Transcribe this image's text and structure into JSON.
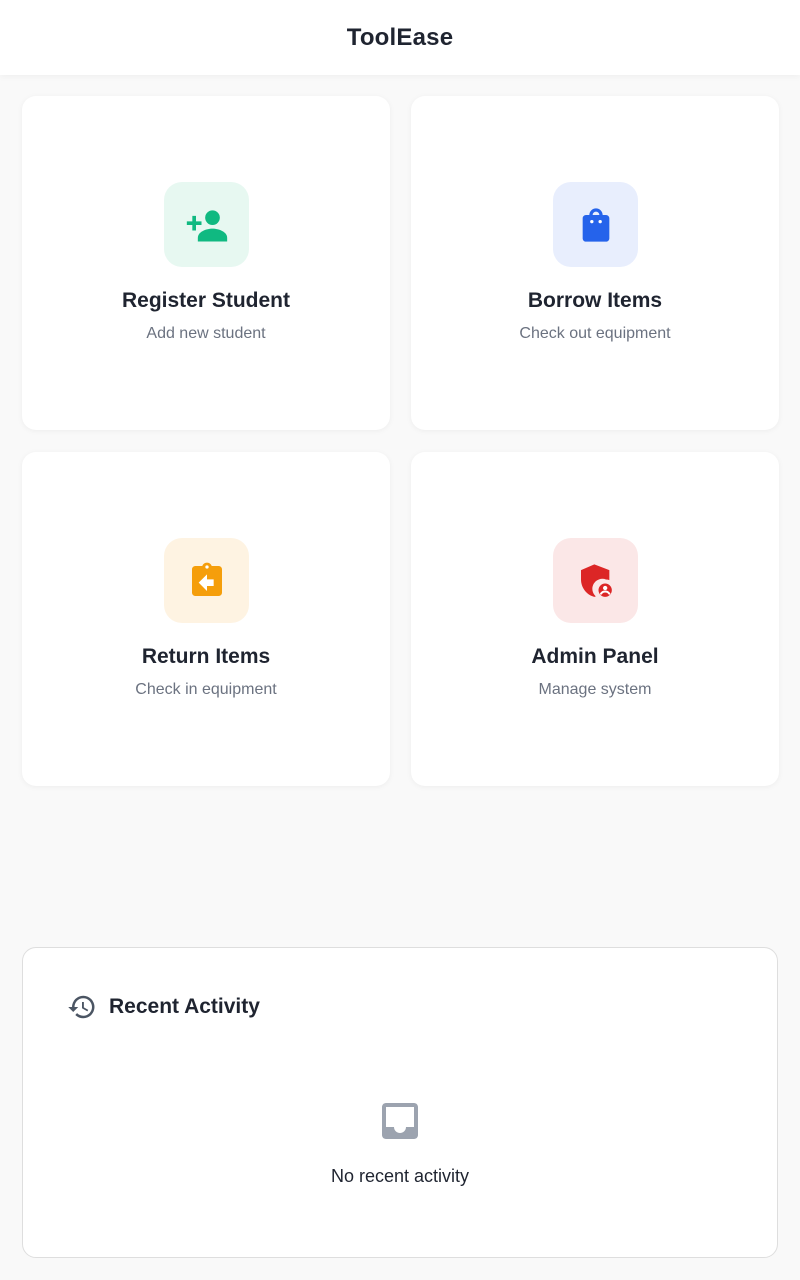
{
  "header": {
    "title": "ToolEase"
  },
  "cards": [
    {
      "title": "Register Student",
      "subtitle": "Add new student",
      "icon": "person-add-icon",
      "color": "#10b981",
      "tint": "#e7f8f1"
    },
    {
      "title": "Borrow Items",
      "subtitle": "Check out equipment",
      "icon": "shopping-bag-icon",
      "color": "#2563eb",
      "tint": "#e8eefd"
    },
    {
      "title": "Return Items",
      "subtitle": "Check in equipment",
      "icon": "assignment-return-icon",
      "color": "#f59e0b",
      "tint": "#fef3e2"
    },
    {
      "title": "Admin Panel",
      "subtitle": "Manage system",
      "icon": "admin-shield-icon",
      "color": "#dc2626",
      "tint": "#fbe7e7"
    }
  ],
  "recent_activity": {
    "title": "Recent Activity",
    "icon": "history-icon",
    "empty_icon": "inbox-icon",
    "empty_text": "No recent activity"
  }
}
